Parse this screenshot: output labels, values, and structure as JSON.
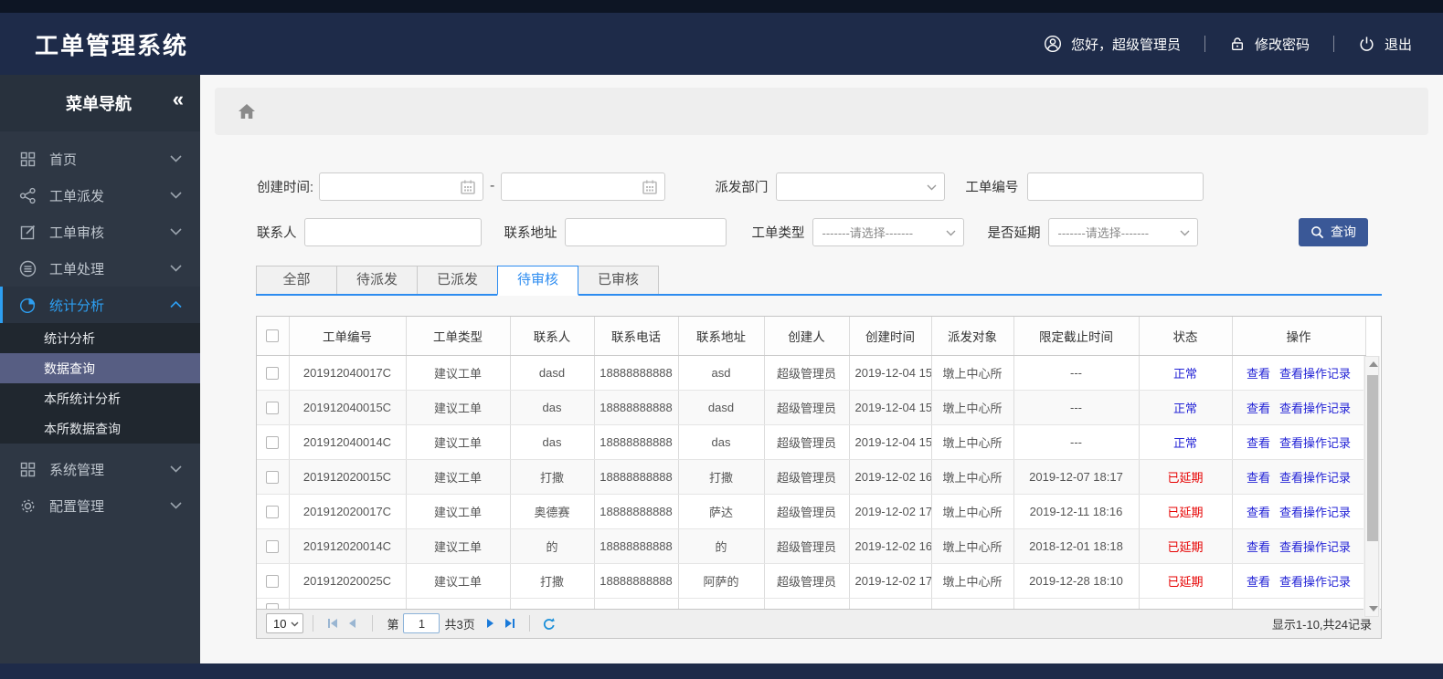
{
  "header": {
    "app_title": "工单管理系统",
    "greeting": "您好，超级管理员",
    "change_password": "修改密码",
    "logout": "退出"
  },
  "sidebar": {
    "title": "菜单导航",
    "collapse": "«",
    "menu": [
      {
        "label": "首页",
        "icon": "grid-icon"
      },
      {
        "label": "工单派发",
        "icon": "share-icon"
      },
      {
        "label": "工单审核",
        "icon": "edit-icon"
      },
      {
        "label": "工单处理",
        "icon": "database-icon"
      },
      {
        "label": "统计分析",
        "icon": "pie-chart-icon",
        "expanded": true
      },
      {
        "label": "系统管理",
        "icon": "grid-icon"
      },
      {
        "label": "配置管理",
        "icon": "gear-icon"
      }
    ],
    "submenu": [
      {
        "label": "统计分析"
      },
      {
        "label": "数据查询",
        "selected": true
      },
      {
        "label": "本所统计分析"
      },
      {
        "label": "本所数据查询"
      }
    ]
  },
  "filters": {
    "created_time_label": "创建时间:",
    "range_separator": "-",
    "dispatch_dept_label": "派发部门",
    "order_no_label": "工单编号",
    "contact_label": "联系人",
    "address_label": "联系地址",
    "order_type_label": "工单类型",
    "delayed_label": "是否延期",
    "select_placeholder": "-------请选择-------",
    "search_button": "查询"
  },
  "tabs": [
    {
      "label": "全部"
    },
    {
      "label": "待派发"
    },
    {
      "label": "已派发"
    },
    {
      "label": "待审核",
      "active": true
    },
    {
      "label": "已审核"
    }
  ],
  "table": {
    "columns": [
      "工单编号",
      "工单类型",
      "联系人",
      "联系电话",
      "联系地址",
      "创建人",
      "创建时间",
      "派发对象",
      "限定截止时间",
      "状态",
      "操作"
    ],
    "ops": {
      "view": "查看",
      "log": "查看操作记录"
    },
    "rows": [
      {
        "id": "201912040017C",
        "type": "建议工单",
        "contact": "dasd",
        "phone": "18888888888",
        "address": "asd",
        "creator": "超级管理员",
        "created": "2019-12-04 15",
        "target": "墩上中心所",
        "deadline": "---",
        "status": "正常",
        "status_state": "normal"
      },
      {
        "id": "201912040015C",
        "type": "建议工单",
        "contact": "das",
        "phone": "18888888888",
        "address": "dasd",
        "creator": "超级管理员",
        "created": "2019-12-04 15",
        "target": "墩上中心所",
        "deadline": "---",
        "status": "正常",
        "status_state": "normal"
      },
      {
        "id": "201912040014C",
        "type": "建议工单",
        "contact": "das",
        "phone": "18888888888",
        "address": "das",
        "creator": "超级管理员",
        "created": "2019-12-04 15",
        "target": "墩上中心所",
        "deadline": "---",
        "status": "正常",
        "status_state": "normal"
      },
      {
        "id": "201912020015C",
        "type": "建议工单",
        "contact": "打撒",
        "phone": "18888888888",
        "address": "打撒",
        "creator": "超级管理员",
        "created": "2019-12-02 16",
        "target": "墩上中心所",
        "deadline": "2019-12-07 18:17",
        "status": "已延期",
        "status_state": "delayed"
      },
      {
        "id": "201912020017C",
        "type": "建议工单",
        "contact": "奥德赛",
        "phone": "18888888888",
        "address": "萨达",
        "creator": "超级管理员",
        "created": "2019-12-02 17",
        "target": "墩上中心所",
        "deadline": "2019-12-11 18:16",
        "status": "已延期",
        "status_state": "delayed"
      },
      {
        "id": "201912020014C",
        "type": "建议工单",
        "contact": "的",
        "phone": "18888888888",
        "address": "的",
        "creator": "超级管理员",
        "created": "2019-12-02 16",
        "target": "墩上中心所",
        "deadline": "2018-12-01 18:18",
        "status": "已延期",
        "status_state": "delayed"
      },
      {
        "id": "201912020025C",
        "type": "建议工单",
        "contact": "打撒",
        "phone": "18888888888",
        "address": "阿萨的",
        "creator": "超级管理员",
        "created": "2019-12-02 17",
        "target": "墩上中心所",
        "deadline": "2019-12-28 18:10",
        "status": "已延期",
        "status_state": "delayed"
      }
    ]
  },
  "pagination": {
    "page_size": "10",
    "page_prefix": "第",
    "current_page": "1",
    "total_pages": "共3页",
    "summary": "显示1-10,共24记录"
  },
  "colors": {
    "header_bg": "#1e2b49",
    "sidebar_bg": "#2e3744",
    "accent_blue": "#2d9ff2",
    "tab_blue": "#2d8cf0",
    "link_blue": "#2424d6",
    "status_red": "#e60000",
    "button_bg": "#3a5897",
    "submenu_selected_bg": "#575e83"
  }
}
